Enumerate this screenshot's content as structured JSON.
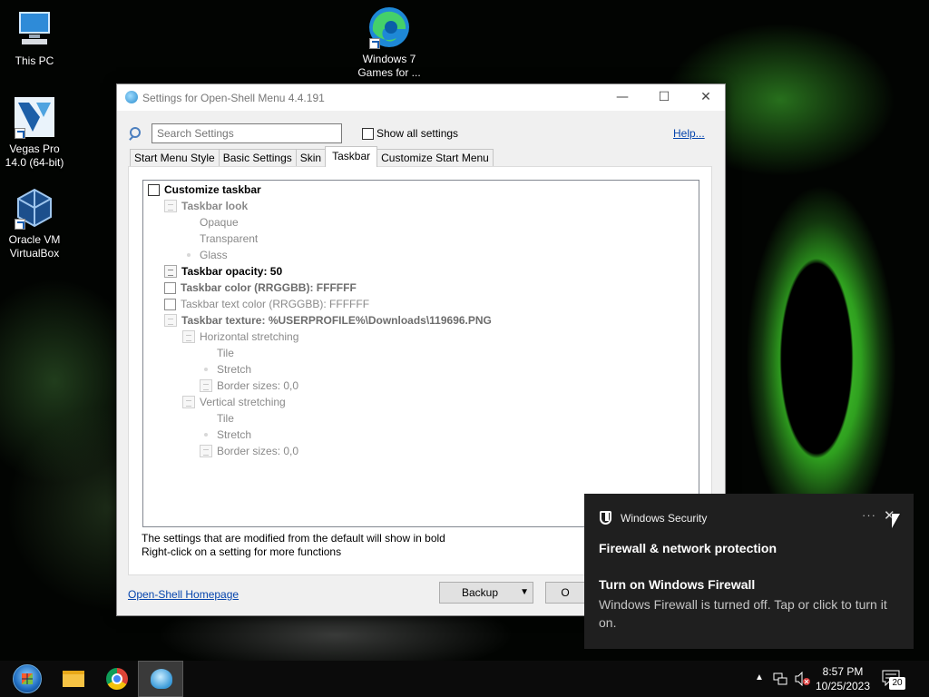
{
  "desktop": {
    "icons": [
      {
        "label": "This PC"
      },
      {
        "label": "Windows 7\nGames for ..."
      },
      {
        "label": "Vegas Pro\n14.0 (64-bit)"
      },
      {
        "label": "Oracle VM\nVirtualBox"
      }
    ]
  },
  "dialog": {
    "title": "Settings for Open-Shell Menu 4.4.191",
    "search_placeholder": "Search Settings",
    "show_all_label": "Show all settings",
    "help_label": "Help...",
    "tabs": [
      {
        "label": "Start Menu Style"
      },
      {
        "label": "Basic Settings"
      },
      {
        "label": "Skin"
      },
      {
        "label": "Taskbar"
      },
      {
        "label": "Customize Start Menu"
      }
    ],
    "tree": {
      "customize_taskbar": "Customize taskbar",
      "taskbar_look": "Taskbar look",
      "opaque": "Opaque",
      "transparent": "Transparent",
      "glass": "Glass",
      "opacity": "Taskbar opacity: 50",
      "color": "Taskbar color (RRGGBB): FFFFFF",
      "text_color": "Taskbar text color (RRGGBB): FFFFFF",
      "texture": "Taskbar texture: %USERPROFILE%\\Downloads\\119696.PNG",
      "h_stretch": "Horizontal stretching",
      "h_tile": "Tile",
      "h_stretch_opt": "Stretch",
      "h_border": "Border sizes: 0,0",
      "v_stretch": "Vertical stretching",
      "v_tile": "Tile",
      "v_stretch_opt": "Stretch",
      "v_border": "Border sizes: 0,0"
    },
    "note_line1": "The settings that are modified from the default will show in bold",
    "note_line2": "Right-click on a setting for more functions",
    "homepage_label": "Open-Shell Homepage",
    "backup_label": "Backup",
    "ok_label": "O"
  },
  "toast": {
    "app_name": "Windows Security",
    "more": "···",
    "close": "✕",
    "heading": "Firewall & network protection",
    "subheading": "Turn on Windows Firewall",
    "body": "Windows Firewall is turned off. Tap or click to turn it on."
  },
  "taskbar": {
    "time": "8:57 PM",
    "date": "10/25/2023",
    "notification_count": "20"
  }
}
